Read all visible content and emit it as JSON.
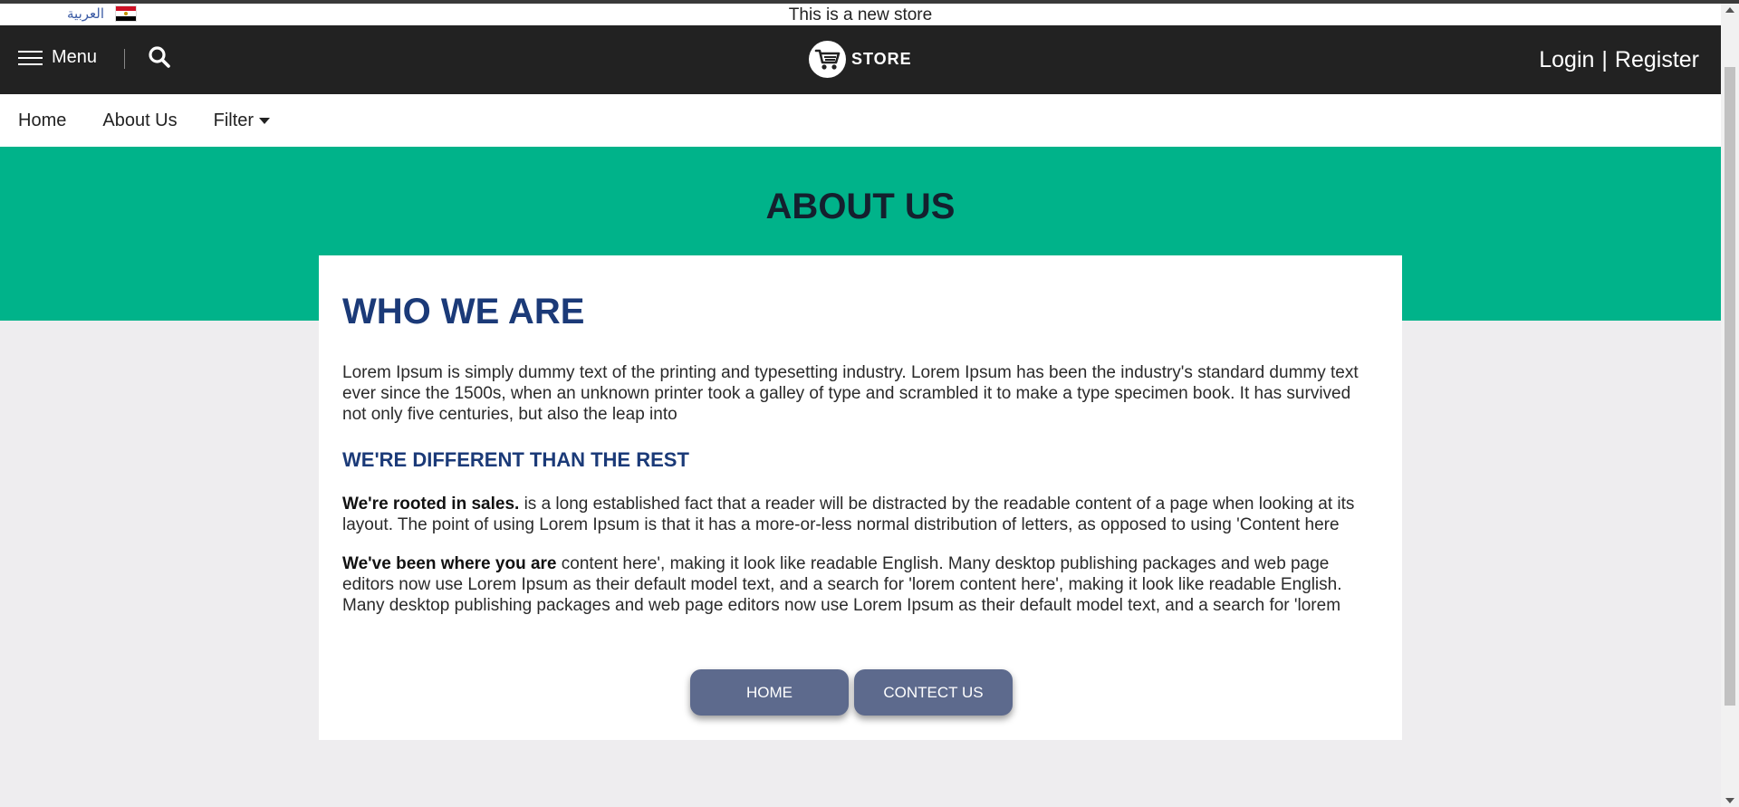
{
  "announcement": {
    "language_link": "العربية",
    "flag_icon": "egypt-flag-icon",
    "text": "This is a new store"
  },
  "header": {
    "menu_label": "Menu",
    "logo_text": "STORE",
    "login_label": "Login",
    "separator": "|",
    "register_label": "Register"
  },
  "nav": {
    "items": [
      {
        "label": "Home"
      },
      {
        "label": "About Us"
      },
      {
        "label": "Filter"
      }
    ]
  },
  "banner": {
    "title": "ABOUT US"
  },
  "content": {
    "heading": "WHO WE ARE",
    "intro": "Lorem Ipsum is simply dummy text of the printing and typesetting industry. Lorem Ipsum has been the industry's standard dummy text ever since the 1500s, when an unknown printer took a galley of type and scrambled it to make a type specimen book. It has survived not only five centuries, but also the leap into",
    "subheading": "WE'RE DIFFERENT THAN THE REST",
    "para1_bold": "We're rooted in sales.",
    "para1_text": " is a long established fact that a reader will be distracted by the readable content of a page when looking at its layout. The point of using Lorem Ipsum is that it has a more-or-less normal distribution of letters, as opposed to using 'Content here",
    "para2_bold": "We've been where you are",
    "para2_text": " content here', making it look like readable English. Many desktop publishing packages and web page editors now use Lorem Ipsum as their default model text, and a search for 'lorem content here', making it look like readable English. Many desktop publishing packages and web page editors now use Lorem Ipsum as their default model text, and a search for 'lorem",
    "buttons": {
      "home": "HOME",
      "contact": "CONTECT US"
    }
  },
  "colors": {
    "header_bg": "#222222",
    "banner_bg": "#00b38a",
    "heading": "#1b3a78",
    "button_bg": "#5d6a8d",
    "page_bg": "#eeedef"
  }
}
